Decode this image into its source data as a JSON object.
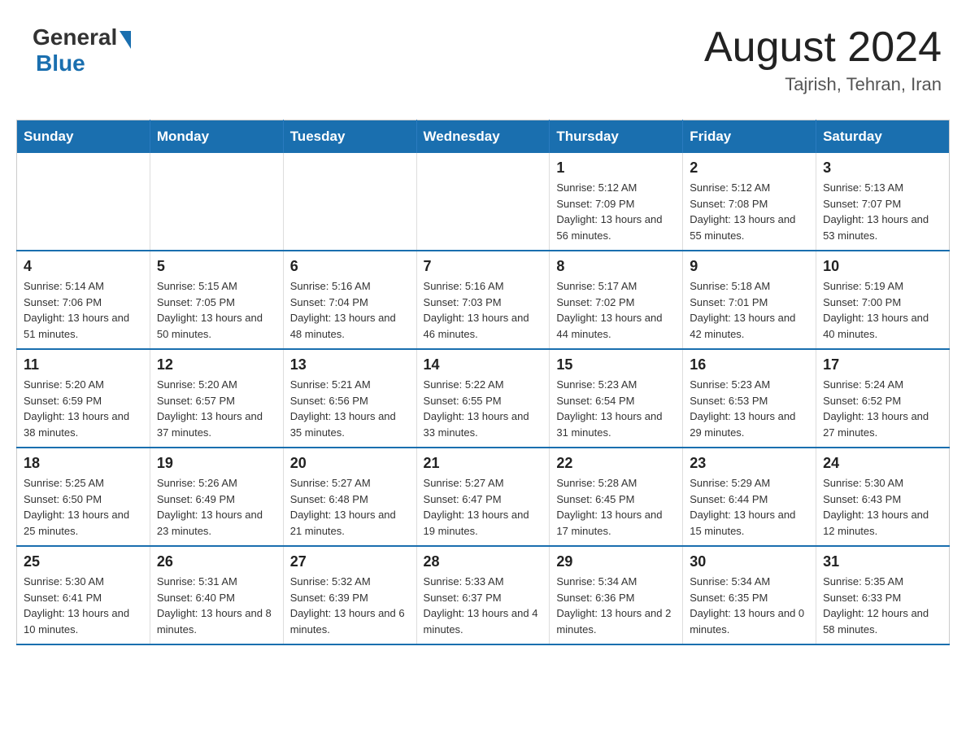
{
  "header": {
    "logo_general": "General",
    "logo_blue": "Blue",
    "title": "August 2024",
    "subtitle": "Tajrish, Tehran, Iran"
  },
  "days_of_week": [
    "Sunday",
    "Monday",
    "Tuesday",
    "Wednesday",
    "Thursday",
    "Friday",
    "Saturday"
  ],
  "weeks": [
    [
      {
        "day": "",
        "info": ""
      },
      {
        "day": "",
        "info": ""
      },
      {
        "day": "",
        "info": ""
      },
      {
        "day": "",
        "info": ""
      },
      {
        "day": "1",
        "info": "Sunrise: 5:12 AM\nSunset: 7:09 PM\nDaylight: 13 hours and 56 minutes."
      },
      {
        "day": "2",
        "info": "Sunrise: 5:12 AM\nSunset: 7:08 PM\nDaylight: 13 hours and 55 minutes."
      },
      {
        "day": "3",
        "info": "Sunrise: 5:13 AM\nSunset: 7:07 PM\nDaylight: 13 hours and 53 minutes."
      }
    ],
    [
      {
        "day": "4",
        "info": "Sunrise: 5:14 AM\nSunset: 7:06 PM\nDaylight: 13 hours and 51 minutes."
      },
      {
        "day": "5",
        "info": "Sunrise: 5:15 AM\nSunset: 7:05 PM\nDaylight: 13 hours and 50 minutes."
      },
      {
        "day": "6",
        "info": "Sunrise: 5:16 AM\nSunset: 7:04 PM\nDaylight: 13 hours and 48 minutes."
      },
      {
        "day": "7",
        "info": "Sunrise: 5:16 AM\nSunset: 7:03 PM\nDaylight: 13 hours and 46 minutes."
      },
      {
        "day": "8",
        "info": "Sunrise: 5:17 AM\nSunset: 7:02 PM\nDaylight: 13 hours and 44 minutes."
      },
      {
        "day": "9",
        "info": "Sunrise: 5:18 AM\nSunset: 7:01 PM\nDaylight: 13 hours and 42 minutes."
      },
      {
        "day": "10",
        "info": "Sunrise: 5:19 AM\nSunset: 7:00 PM\nDaylight: 13 hours and 40 minutes."
      }
    ],
    [
      {
        "day": "11",
        "info": "Sunrise: 5:20 AM\nSunset: 6:59 PM\nDaylight: 13 hours and 38 minutes."
      },
      {
        "day": "12",
        "info": "Sunrise: 5:20 AM\nSunset: 6:57 PM\nDaylight: 13 hours and 37 minutes."
      },
      {
        "day": "13",
        "info": "Sunrise: 5:21 AM\nSunset: 6:56 PM\nDaylight: 13 hours and 35 minutes."
      },
      {
        "day": "14",
        "info": "Sunrise: 5:22 AM\nSunset: 6:55 PM\nDaylight: 13 hours and 33 minutes."
      },
      {
        "day": "15",
        "info": "Sunrise: 5:23 AM\nSunset: 6:54 PM\nDaylight: 13 hours and 31 minutes."
      },
      {
        "day": "16",
        "info": "Sunrise: 5:23 AM\nSunset: 6:53 PM\nDaylight: 13 hours and 29 minutes."
      },
      {
        "day": "17",
        "info": "Sunrise: 5:24 AM\nSunset: 6:52 PM\nDaylight: 13 hours and 27 minutes."
      }
    ],
    [
      {
        "day": "18",
        "info": "Sunrise: 5:25 AM\nSunset: 6:50 PM\nDaylight: 13 hours and 25 minutes."
      },
      {
        "day": "19",
        "info": "Sunrise: 5:26 AM\nSunset: 6:49 PM\nDaylight: 13 hours and 23 minutes."
      },
      {
        "day": "20",
        "info": "Sunrise: 5:27 AM\nSunset: 6:48 PM\nDaylight: 13 hours and 21 minutes."
      },
      {
        "day": "21",
        "info": "Sunrise: 5:27 AM\nSunset: 6:47 PM\nDaylight: 13 hours and 19 minutes."
      },
      {
        "day": "22",
        "info": "Sunrise: 5:28 AM\nSunset: 6:45 PM\nDaylight: 13 hours and 17 minutes."
      },
      {
        "day": "23",
        "info": "Sunrise: 5:29 AM\nSunset: 6:44 PM\nDaylight: 13 hours and 15 minutes."
      },
      {
        "day": "24",
        "info": "Sunrise: 5:30 AM\nSunset: 6:43 PM\nDaylight: 13 hours and 12 minutes."
      }
    ],
    [
      {
        "day": "25",
        "info": "Sunrise: 5:30 AM\nSunset: 6:41 PM\nDaylight: 13 hours and 10 minutes."
      },
      {
        "day": "26",
        "info": "Sunrise: 5:31 AM\nSunset: 6:40 PM\nDaylight: 13 hours and 8 minutes."
      },
      {
        "day": "27",
        "info": "Sunrise: 5:32 AM\nSunset: 6:39 PM\nDaylight: 13 hours and 6 minutes."
      },
      {
        "day": "28",
        "info": "Sunrise: 5:33 AM\nSunset: 6:37 PM\nDaylight: 13 hours and 4 minutes."
      },
      {
        "day": "29",
        "info": "Sunrise: 5:34 AM\nSunset: 6:36 PM\nDaylight: 13 hours and 2 minutes."
      },
      {
        "day": "30",
        "info": "Sunrise: 5:34 AM\nSunset: 6:35 PM\nDaylight: 13 hours and 0 minutes."
      },
      {
        "day": "31",
        "info": "Sunrise: 5:35 AM\nSunset: 6:33 PM\nDaylight: 12 hours and 58 minutes."
      }
    ]
  ]
}
